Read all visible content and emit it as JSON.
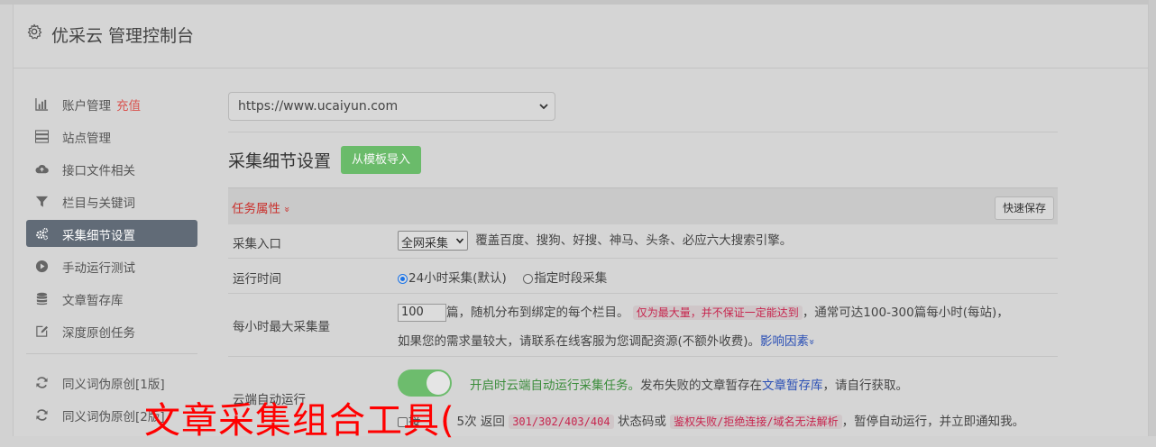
{
  "app": {
    "title": "优采云 管理控制台"
  },
  "sidebar": {
    "items": [
      {
        "label": "账户管理",
        "extra": "充值",
        "icon": "bar-chart-icon"
      },
      {
        "label": "站点管理",
        "icon": "server-icon"
      },
      {
        "label": "接口文件相关",
        "icon": "cloud-upload-icon"
      },
      {
        "label": "栏目与关键词",
        "icon": "filter-icon"
      },
      {
        "label": "采集细节设置",
        "icon": "cogs-icon",
        "active": true
      },
      {
        "label": "手动运行测试",
        "icon": "play-circle-icon"
      },
      {
        "label": "文章暂存库",
        "icon": "database-icon"
      },
      {
        "label": "深度原创任务",
        "icon": "edit-icon"
      }
    ],
    "secondary": [
      {
        "label": "同义词伪原创[1版]",
        "icon": "refresh-icon"
      },
      {
        "label": "同义词伪原创[2版]",
        "icon": "refresh-icon"
      }
    ]
  },
  "main": {
    "site_select": {
      "value": "https://www.ucaiyun.com"
    },
    "section_title": "采集细节设置",
    "import_button": "从模板导入",
    "task_tab": "任务属性",
    "task_tab_chevron": "»",
    "quick_save": "快速保存",
    "rows": {
      "entry": {
        "label": "采集入口",
        "select_value": "全网采集",
        "desc": "覆盖百度、搜狗、好搜、神马、头条、必应六大搜索引擎。"
      },
      "runtime": {
        "label": "运行时间",
        "option1": "24小时采集(默认)",
        "option2": "指定时段采集",
        "selected": "option1"
      },
      "max": {
        "label": "每小时最大采集量",
        "value": "100",
        "text1": "篇，随机分布到绑定的每个栏目。",
        "warn": "仅为最大量，并不保证一定能达到",
        "text2": "，通常可达100-300篇每小时(每站)，",
        "text3": "如果您的需求量较大，请联系在线客服为您调配资源(不额外收费)。",
        "link": "影响因素",
        "link_chevron": "»"
      },
      "cloud": {
        "label": "云端自动运行",
        "toggle_on": true,
        "green": "开启时云端自动运行采集任务。",
        "text1": "发布失败的文章暂存在",
        "link": "文章暂存库",
        "text2": "，请自行获取。",
        "line2_a": "接",
        "line2_b": "5次 返回",
        "codes": "301/302/403/404",
        "line2_c": "状态码或",
        "errors": "鉴权失败/拒绝连接/域名无法解析",
        "line2_d": "，暂停自动运行，并立即通知我。"
      }
    }
  },
  "overlay_caption": "文章采集组合工具("
}
